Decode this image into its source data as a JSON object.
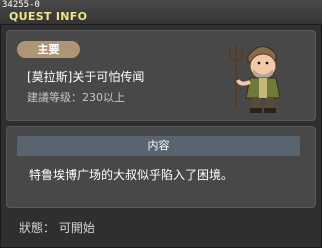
{
  "window": {
    "quest_id": "34255-0",
    "title": "QUEST INFO"
  },
  "info": {
    "tag": "主要",
    "quest_name": "[莫拉斯]关于可怕传闻",
    "level_requirement": "建議等级：230以上",
    "npc_icon": "farmer-npc-with-pitchfork"
  },
  "content": {
    "header": "内容",
    "text": "特鲁埃博广场的大叔似乎陷入了困境。"
  },
  "status": {
    "text": "狀態： 可開始"
  },
  "colors": {
    "title": "#f2e488",
    "tag_bg": "#b09575",
    "header_bg": "#586470",
    "panel_bg": "#484848"
  }
}
